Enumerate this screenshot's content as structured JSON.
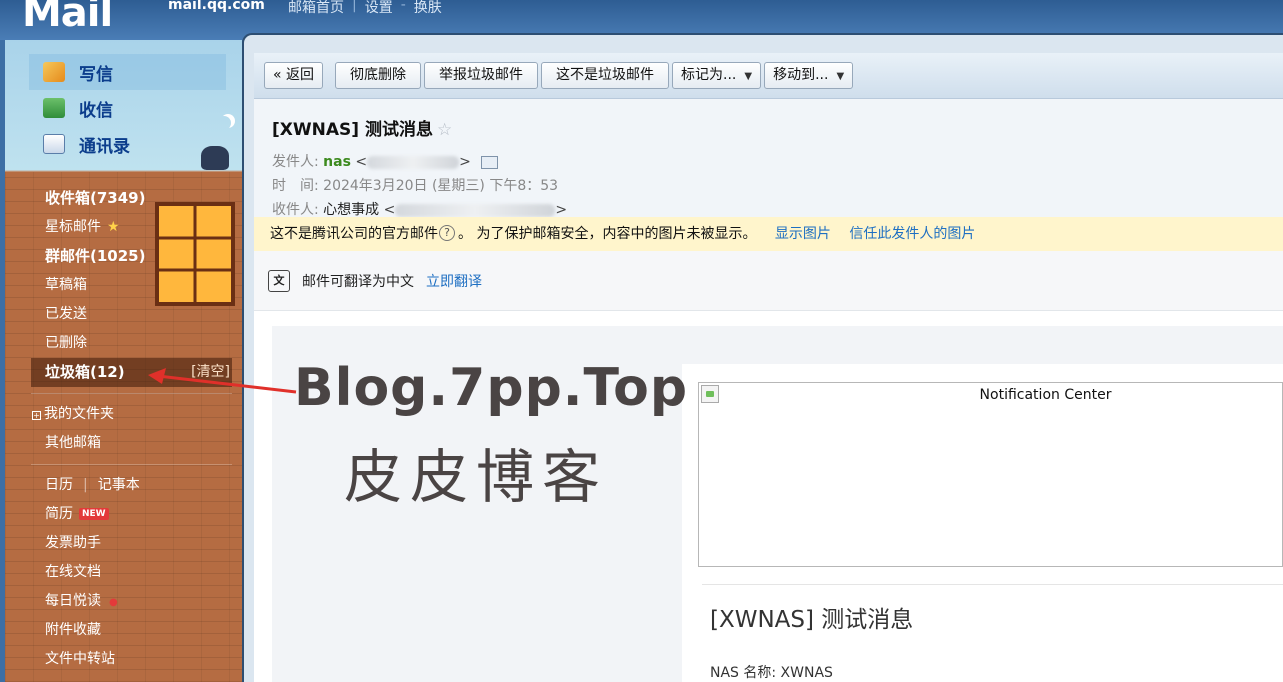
{
  "header": {
    "logo_text": "Mail",
    "domain": "mail.qq.com",
    "links": [
      "邮箱首页",
      "设置",
      "换肤"
    ]
  },
  "sidebar": {
    "quick": [
      {
        "label": "写信",
        "icon": "pencil-icon"
      },
      {
        "label": "收信",
        "icon": "inbox-download-icon"
      },
      {
        "label": "通讯录",
        "icon": "contact-card-icon"
      }
    ],
    "folders": {
      "inbox": "收件箱(7349)",
      "starred": "星标邮件",
      "group": "群邮件(1025)",
      "drafts": "草稿箱",
      "sent": "已发送",
      "deleted": "已删除",
      "spam": "垃圾箱(12)",
      "spam_clear": "[清空]",
      "my_folders": "我的文件夹",
      "other_mailbox": "其他邮箱",
      "calendar": "日历",
      "notes": "记事本",
      "resume": "简历",
      "resume_badge": "NEW",
      "invoice": "发票助手",
      "online_docs": "在线文档",
      "daily_reading": "每日悦读",
      "attachments": "附件收藏",
      "file_transfer": "文件中转站"
    }
  },
  "toolbar": {
    "back": "« 返回",
    "delete_forever": "彻底删除",
    "report_spam": "举报垃圾邮件",
    "not_spam": "这不是垃圾邮件",
    "mark_as": "标记为...",
    "move_to": "移动到..."
  },
  "mail": {
    "subject": "[XWNAS] 测试消息",
    "from_label": "发件人:",
    "from_name": "nas",
    "from_addr_open": "<",
    "from_addr_close": ">",
    "time_label": "时　间:",
    "time_value": "2024年3月20日 (星期三) 下午8：53",
    "to_label": "收件人:",
    "to_name": "心想事成",
    "to_addr_open": "<",
    "to_addr_close": ">"
  },
  "warning": {
    "text1": "这不是腾讯公司的官方邮件",
    "text2": "。 为了保护邮箱安全，内容中的图片未被显示。",
    "show_images": "显示图片",
    "trust_sender": "信任此发件人的图片"
  },
  "translate": {
    "text": "邮件可翻译为中文",
    "action": "立即翻译"
  },
  "content": {
    "image_alt": "Notification Center",
    "title": "[XWNAS] 测试消息",
    "nas_name": "NAS 名称: XWNAS"
  },
  "watermark": {
    "line1": "Blog.7pp.Top",
    "line2": "皮皮博客"
  }
}
